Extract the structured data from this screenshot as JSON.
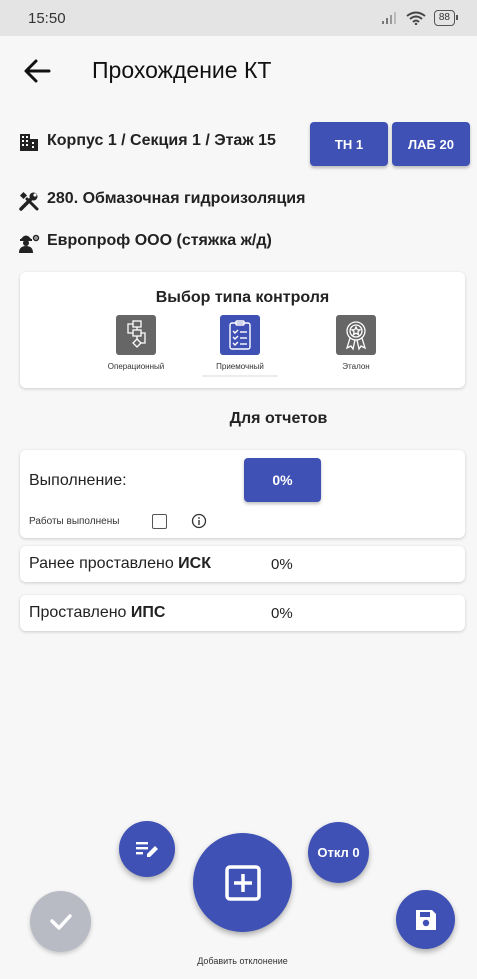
{
  "status_bar": {
    "time": "15:50",
    "battery": "88"
  },
  "header": {
    "title": "Прохождение КТ"
  },
  "info": {
    "location": "Корпус 1 / Секция 1 / Этаж 15",
    "work": "280. Обмазочная гидроизоляция",
    "contractor": "Европроф ООО (стяжка ж/д)"
  },
  "tags": {
    "th": "ТН 1",
    "lab": "ЛАБ 20"
  },
  "control_type": {
    "title": "Выбор типа контроля",
    "options": [
      {
        "label": "Операционный",
        "icon": "flowchart-icon",
        "selected": false
      },
      {
        "label": "Приемочный",
        "icon": "clipboard-checklist-icon",
        "selected": true
      },
      {
        "label": "Эталон",
        "icon": "award-ribbon-icon",
        "selected": false
      }
    ]
  },
  "reports": {
    "title": "Для отчетов",
    "execution_label": "Выполнение:",
    "execution_value": "0%",
    "works_done_label": "Работы выполнены",
    "works_done_checked": false
  },
  "rows": [
    {
      "prefix": "Ранее проставлено ",
      "bold": "ИСК",
      "value": "0%"
    },
    {
      "prefix": "Проставлено ",
      "bold": "ИПС",
      "value": "0%"
    }
  ],
  "actions": {
    "deviations_button": "Откл 0",
    "add_deviation_label": "Добавить отклонение"
  },
  "colors": {
    "accent": "#3f51b5",
    "disabled": "#b9bbc4",
    "background": "#f7f7f7"
  }
}
